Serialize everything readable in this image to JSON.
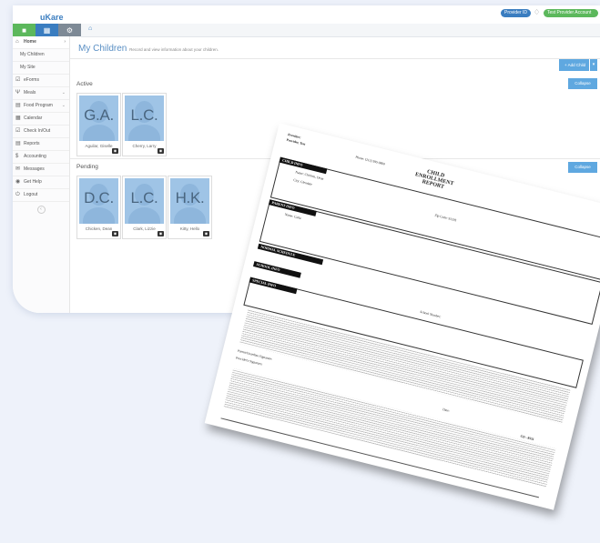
{
  "app": {
    "logo_text": "uKare",
    "provider_pill": "Provider ID",
    "user_pill": "Test Provider Account"
  },
  "colors": {
    "accent": "#5fa8e0",
    "green": "#5cb85c",
    "blue": "#3a7dc0"
  },
  "sidebar": {
    "items": [
      {
        "label": "Home",
        "icon": "home-icon"
      },
      {
        "label": "My Children",
        "icon": ""
      },
      {
        "label": "My Site",
        "icon": ""
      },
      {
        "label": "eForms",
        "icon": "check-icon"
      },
      {
        "label": "Meals",
        "icon": "cutlery-icon"
      },
      {
        "label": "Food Program",
        "icon": "list-icon"
      },
      {
        "label": "Calendar",
        "icon": "calendar-icon"
      },
      {
        "label": "Check In/Out",
        "icon": "check-icon"
      },
      {
        "label": "Reports",
        "icon": "report-icon"
      },
      {
        "label": "Accounting",
        "icon": "dollar-icon"
      },
      {
        "label": "Messages",
        "icon": "mail-icon"
      },
      {
        "label": "Get Help",
        "icon": "help-icon"
      },
      {
        "label": "Logout",
        "icon": "power-icon"
      }
    ]
  },
  "main": {
    "title": "My Children",
    "subtitle": "Record and view information about your children.",
    "add_button": "+ Add Child",
    "collapse_label": "Collapse",
    "active": {
      "title": "Active",
      "children": [
        {
          "initials": "G.A.",
          "name": "Aguilar, Giselle"
        },
        {
          "initials": "L.C.",
          "name": "Cherry, Larry"
        }
      ]
    },
    "pending": {
      "title": "Pending",
      "children": [
        {
          "initials": "D.C.",
          "name": "Chicken, Dean"
        },
        {
          "initials": "L.C.",
          "name": "Clark, Lizzie"
        },
        {
          "initials": "H.K.",
          "name": "Kitty, Hello"
        }
      ]
    }
  },
  "document": {
    "title_line1": "CHILD",
    "title_line2": "ENROLLMENT",
    "title_line3": "REPORT",
    "provider_label": "Provider:",
    "provider_value": "Provider, Test",
    "provider_phone": "Phone: (213) 595-9800",
    "sections": [
      "CHILD INFO",
      "PARENT INFO",
      "NORMAL SCHEDULE",
      "SCHOOL INFO",
      "SPECIAL INFO"
    ],
    "child_name": "Name: Chicken, Dean",
    "child_city": "City: Glendale",
    "child_zip": "Zip Code: 91205",
    "parent_name": "Name: Carla",
    "school_number": "School Number:",
    "signature_label": "Provider's Signature:",
    "parent_signature_label": "Parent/Guardian Signature:",
    "date_label": "Date:",
    "form_code": "CD - 8551"
  }
}
